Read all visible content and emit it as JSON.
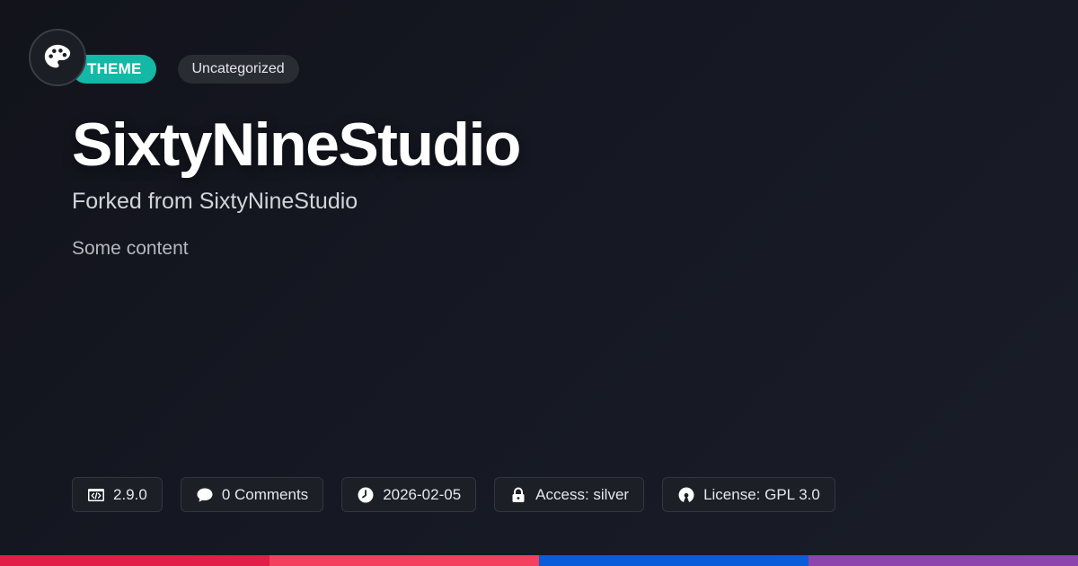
{
  "badges": {
    "type_label": "THEME",
    "category_label": "Uncategorized"
  },
  "post": {
    "title": "SixtyNineStudio",
    "subtitle": "Forked from SixtyNineStudio",
    "content": "Some content"
  },
  "meta": {
    "version": "2.9.0",
    "comments": "0 Comments",
    "date": "2026-02-05",
    "access": "Access: silver",
    "license": "License: GPL 3.0"
  },
  "icons": {
    "logo": "palette-icon",
    "version": "code-icon",
    "comments": "comment-icon",
    "date": "clock-icon",
    "access": "lock-icon",
    "license": "open-source-icon"
  },
  "colors": {
    "accent": "#14b8a6",
    "stripe": [
      "#e11d48",
      "#f43f5e",
      "#0b5cdb",
      "#8e44ad"
    ]
  }
}
